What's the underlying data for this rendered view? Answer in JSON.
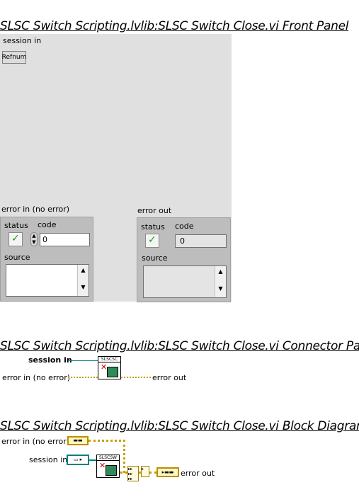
{
  "front_panel": {
    "title": "SLSC Switch Scripting.lvlib:SLSC Switch Close.vi Front Panel",
    "session_label": "session in",
    "session_button": "Refnum",
    "error_in": {
      "label": "error in (no error)",
      "status_label": "status",
      "code_label": "code",
      "code_value": "0",
      "source_label": "source"
    },
    "error_out": {
      "label": "error out",
      "status_label": "status",
      "code_label": "code",
      "code_value": "0",
      "source_label": "source"
    }
  },
  "connector_pane": {
    "title": "SLSC Switch Scripting.lvlib:SLSC Switch Close.vi Connector Pane",
    "session_in": "session in",
    "error_in": "error in (no error)",
    "error_out": "error out",
    "icon_text": "SLSCSC"
  },
  "block_diagram": {
    "title": "SLSC Switch Scripting.lvlib:SLSC Switch Close.vi Block Diagram",
    "error_in": "error in (no error)",
    "session_in": "session in",
    "error_out": "error out",
    "icon_text": "SLSCSW"
  },
  "colors": {
    "panel": "#e0e0e0",
    "cluster": "#bdbdbd",
    "error_wire": "#d0a000",
    "refnum_wire": "#008080"
  }
}
